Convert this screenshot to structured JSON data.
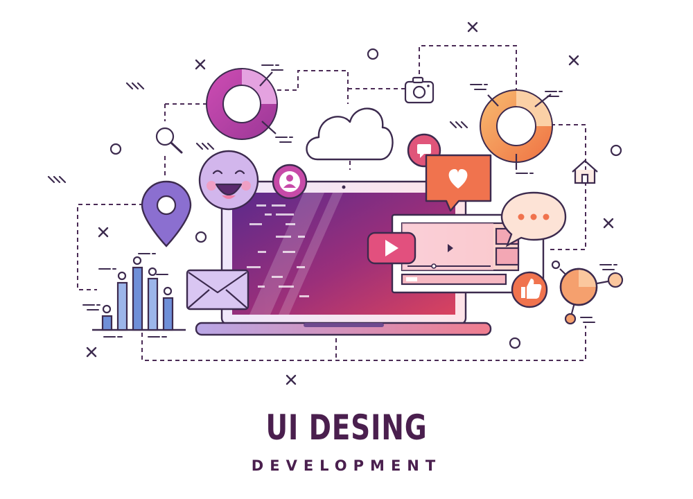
{
  "title": "UI DESING",
  "subtitle": "DEVELOPMENT",
  "colors": {
    "dark_purple": "#4a1f4e",
    "purple": "#a84fb0",
    "pink": "#e0557a",
    "orange": "#f39a4e",
    "blue": "#6f8fd8",
    "lavender": "#9b7fd6"
  },
  "icons": [
    "donut-chart-icon",
    "cloud-icon",
    "camera-icon",
    "search-icon",
    "smiley-icon",
    "user-icon",
    "location-pin-icon",
    "bar-chart-icon",
    "envelope-icon",
    "laptop-icon",
    "chat-icon",
    "heart-icon",
    "speech-bubble-icon",
    "play-button-icon",
    "like-icon",
    "home-icon",
    "network-icon"
  ]
}
